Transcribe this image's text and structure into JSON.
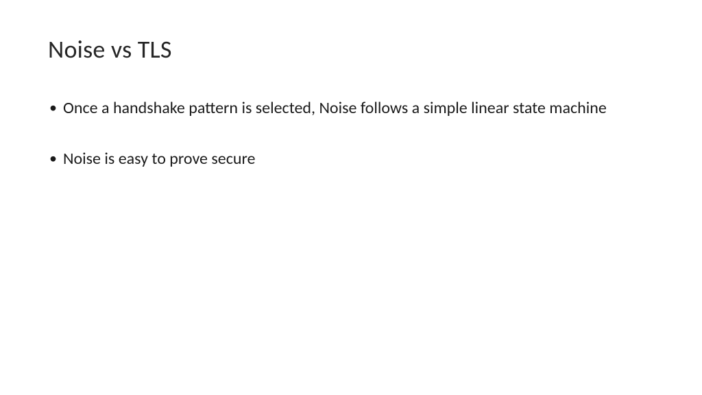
{
  "slide": {
    "title": "Noise vs TLS",
    "bullets": [
      "Once a handshake pattern is selected, Noise follows a simple linear state machine",
      "Noise is easy to prove secure"
    ]
  }
}
